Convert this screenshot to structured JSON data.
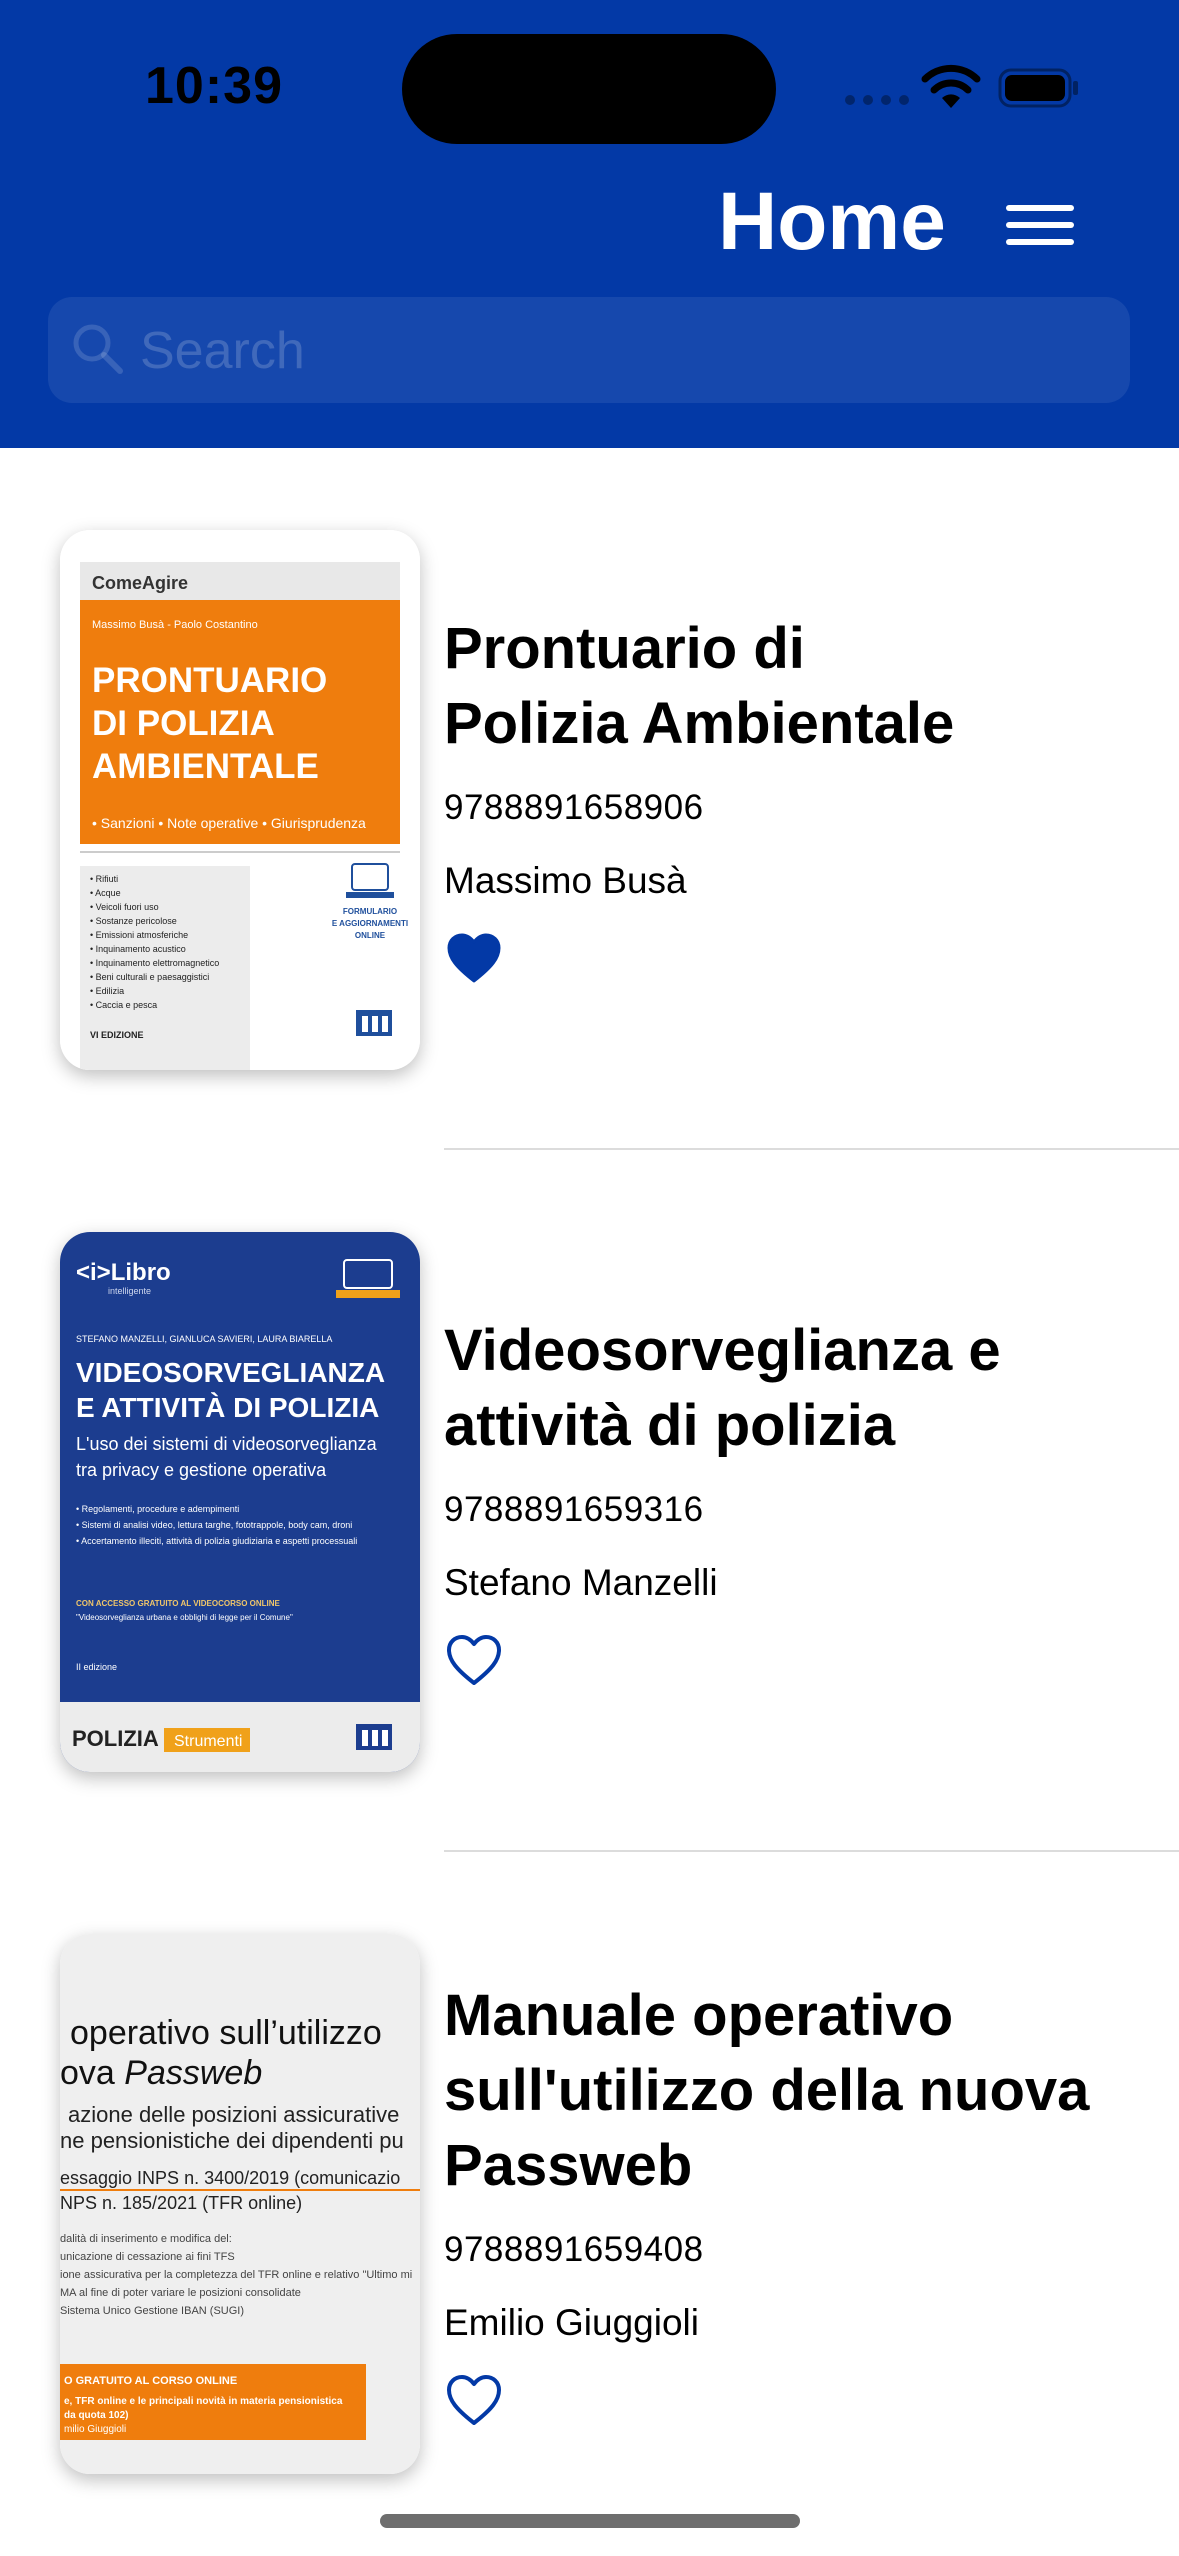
{
  "status_bar": {
    "time": "10:39"
  },
  "header": {
    "title": "Home",
    "background": "#0339a6",
    "menu_icon": "hamburger-menu-icon"
  },
  "search": {
    "placeholder": "Search",
    "icon": "search-icon"
  },
  "colors": {
    "accent": "#0339a6",
    "cover_orange": "#ef7d0d"
  },
  "books": [
    {
      "title": "Prontuario di\nPolizia Ambientale",
      "isbn": "9788891658906",
      "author": "Massimo Busà",
      "favorite": true,
      "cover": {
        "series": "ComeAgire",
        "authors": "Massimo Busà - Paolo Costantino",
        "title_lines": [
          "PRONTUARIO",
          "DI POLIZIA",
          "AMBIENTALE"
        ],
        "tags": "• Sanzioni  • Note operative  • Giurisprudenza",
        "list": [
          "• Rifiuti",
          "• Acque",
          "• Veicoli fuori uso",
          "• Sostanze pericolose",
          "• Emissioni atmosferiche",
          "• Inquinamento acustico",
          "• Inquinamento elettromagnetico",
          "• Beni culturali e paesaggistici",
          "• Edilizia",
          "• Caccia e pesca"
        ],
        "edition": "VI EDIZIONE",
        "side_note": [
          "FORMULARIO",
          "E AGGIORNAMENTI",
          "ONLINE"
        ]
      }
    },
    {
      "title": "Videosorveglianza e\nattività di polizia",
      "isbn": "9788891659316",
      "author": "Stefano Manzelli",
      "favorite": false,
      "cover": {
        "brand": "<i>Libro",
        "brand_sub": "intelligente",
        "authors": "STEFANO MANZELLI, GIANLUCA SAVIERI, LAURA BIARELLA",
        "title_lines": [
          "VIDEOSORVEGLIANZA",
          "E ATTIVITÀ DI POLIZIA"
        ],
        "subtitle_lines": [
          "L'uso dei sistemi di videosorveglianza",
          "tra privacy e gestione operativa"
        ],
        "bullets": [
          "• Regolamenti, procedure e adempimenti",
          "• Sistemi di analisi video, lettura targhe, fototrappole, body cam, droni",
          "• Accertamento illeciti, attività di polizia giudiziaria e aspetti processuali"
        ],
        "access_note": [
          "CON ACCESSO GRATUITO AL VIDEOCORSO ONLINE",
          "\"Videosorveglianza urbana e obblighi di legge per il Comune\""
        ],
        "edition": "II edizione",
        "series": "POLIZIA",
        "series_tag": "Strumenti"
      }
    },
    {
      "title": "Manuale operativo\nsull'utilizzo della nuova\nPassweb",
      "isbn": "9788891659408",
      "author": "Emilio Giuggioli",
      "favorite": false,
      "cover": {
        "title_line1": "operativo sull’utilizzo",
        "title_line2_prefix": "ova ",
        "title_line2_em": "Passweb",
        "subtitle_lines": [
          "azione delle posizioni assicurative",
          "ne pensionistiche dei dipendenti pu"
        ],
        "refs": [
          "essaggio INPS n. 3400/2019 (comunicazio",
          "NPS n. 185/2021 (TFR online)"
        ],
        "small": [
          "dalità di inserimento e modifica del:",
          "unicazione di cessazione ai fini TFS",
          "ione assicurativa per la completezza del TFR online e relativo \"Ultimo mi",
          "MA al fine di poter variare le posizioni consolidate",
          "Sistema Unico Gestione IBAN (SUGI)"
        ],
        "banner": [
          "O GRATUITO AL CORSO ONLINE",
          "e, TFR online e le principali novità in materia pensionistica",
          "da quota 102)",
          "milio Giuggioli"
        ]
      }
    }
  ]
}
